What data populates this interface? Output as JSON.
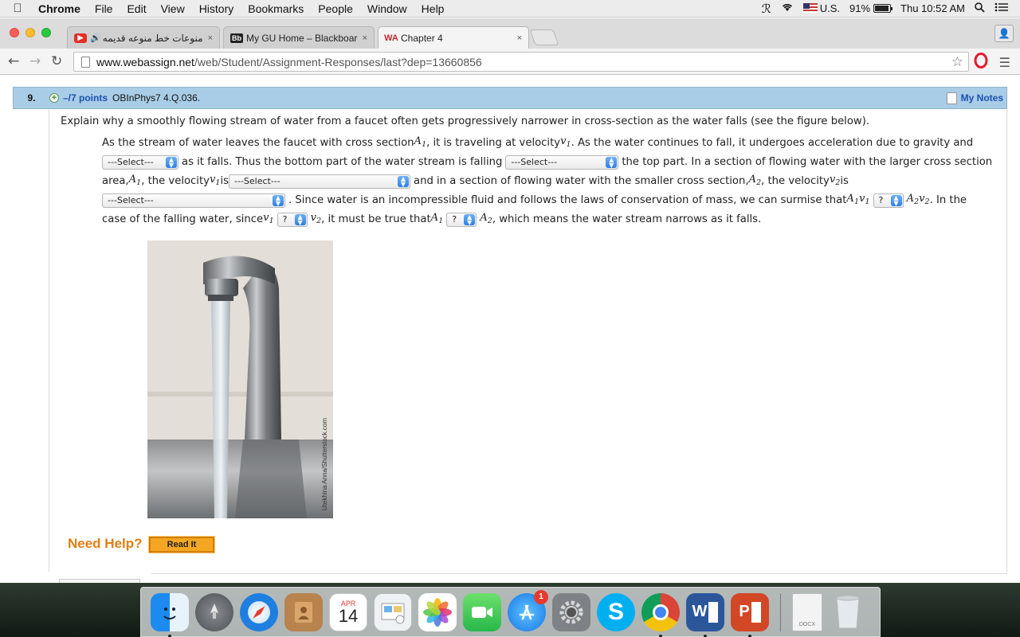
{
  "menubar": {
    "app": "Chrome",
    "items": [
      "File",
      "Edit",
      "View",
      "History",
      "Bookmarks",
      "People",
      "Window",
      "Help"
    ],
    "input_source": "U.S.",
    "battery": "91%",
    "clock": "Thu 10:52 AM"
  },
  "tabs": [
    {
      "label": "منوعات خط منوعه قديمه جديدة -",
      "close": "×"
    },
    {
      "label": "My GU Home – Blackboard",
      "close": "×"
    },
    {
      "label": "Chapter 4",
      "close": "×"
    }
  ],
  "toolbar": {
    "url_host": "www.webassign.net",
    "url_path": "/web/Student/Assignment-Responses/last?dep=13660856"
  },
  "question": {
    "number": "9.",
    "points": "–/7 points",
    "id": "OBInPhys7 4.Q.036.",
    "my_notes": "My Notes",
    "prompt": "Explain why a smoothly flowing stream of water from a faucet often gets progressively narrower in cross-section as the water falls (see the figure below).",
    "line1_a": "As the stream of water leaves the faucet with cross section ",
    "line1_b": ", it is traveling at velocity ",
    "line1_c": ". As the water continues to fall, it undergoes acceleration due to gravity and",
    "line2_a": " as it falls. Thus the bottom part of the water stream is falling ",
    "line2_b": " the top part. In a section of flowing water with the larger cross section",
    "line3_a": "area, ",
    "line3_b": ", the velocity ",
    "line3_c": " is ",
    "line3_d": " and in a section of flowing water with the smaller cross section, ",
    "line3_e": ", the velocity ",
    "line3_f": " is",
    "line4_a": ". Since water is an incompressible fluid and follows the laws of conservation of mass, we can surmise that ",
    "line4_b": ". In the",
    "line5_a": "case of the falling water, since ",
    "line5_b": ", it must be true that ",
    "line5_c": ", which means the water stream narrows as it falls.",
    "select_placeholder": "---Select---",
    "compare_placeholder": "?",
    "var_A": "A",
    "var_v": "v",
    "sub_1": "1",
    "sub_2": "2",
    "image_credit": "Utekhina Anna/Shutterstock.com",
    "need_help": "Need Help?",
    "read_it": "Read It"
  },
  "dock": {
    "calendar_month": "APR",
    "calendar_day": "14",
    "appstore_badge": "1",
    "file_label": "DOCX",
    "word_letter": "W",
    "ppt_letter": "P",
    "skype_letter": "S"
  }
}
